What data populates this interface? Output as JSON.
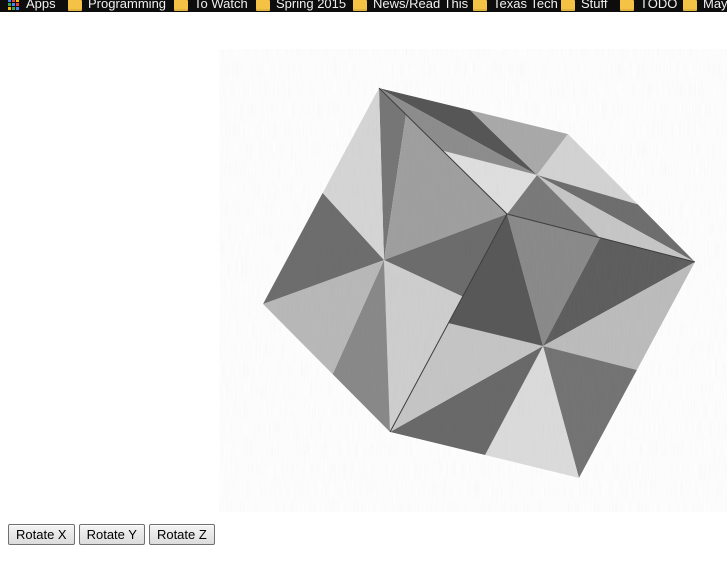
{
  "bookmarks_bar": {
    "apps_label": "Apps",
    "folders": [
      "Programming",
      "To Watch",
      "Spring 2015",
      "News/Read This",
      "Texas Tech",
      "Stuff",
      "TODO",
      "May"
    ]
  },
  "controls": {
    "rotate_x_label": "Rotate X",
    "rotate_y_label": "Rotate Y",
    "rotate_z_label": "Rotate Z"
  },
  "icons": {
    "apps": "apps-grid-icon",
    "folder": "folder-icon"
  },
  "colors": {
    "bookmarks_background": "#0d0d0d",
    "folder": "#f4c244",
    "cube_dark": "#525252",
    "cube_light": "#dadada"
  }
}
